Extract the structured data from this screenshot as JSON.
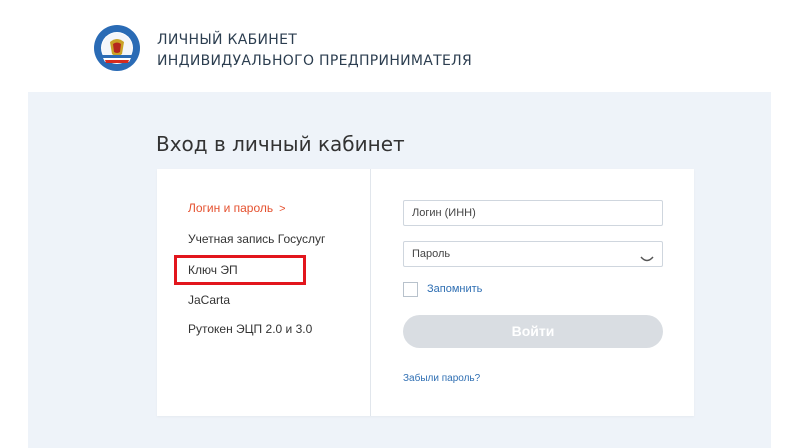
{
  "header": {
    "title_line1": "ЛИЧНЫЙ КАБИНЕТ",
    "title_line2": "ИНДИВИДУАЛЬНОГО ПРЕДПРИНИМАТЕЛЯ",
    "logo_icon": "fns-emblem-icon"
  },
  "login": {
    "heading": "Вход в личный кабинет",
    "methods": [
      {
        "label": "Логин и пароль",
        "active": true,
        "chevron": ">"
      },
      {
        "label": "Учетная запись Госуслуг",
        "active": false
      },
      {
        "label": "Ключ ЭП",
        "active": false
      },
      {
        "label": "JaCarta",
        "active": false
      },
      {
        "label": "Рутокен ЭЦП 2.0 и 3.0",
        "active": false
      }
    ],
    "form": {
      "login_placeholder": "Логин (ИНН)",
      "password_placeholder": "Пароль",
      "remember_label": "Запомнить",
      "submit_label": "Войти",
      "forgot_label": "Забыли пароль?"
    }
  },
  "colors": {
    "accent": "#e5512f",
    "link": "#2f6fb3",
    "highlight": "#e2161d",
    "background": "#eef3f9",
    "button_disabled": "#d9dde2"
  }
}
